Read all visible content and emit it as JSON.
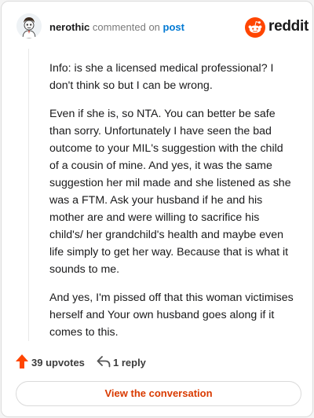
{
  "header": {
    "username": "nerothic",
    "action_text": " commented on ",
    "post_link": "post"
  },
  "brand": {
    "wordmark": "reddit",
    "accent": "#ff4500"
  },
  "comment": {
    "paragraphs": [
      "Info: is she a licensed medical professional? I don't think so but I can be wrong.",
      "Even if she is, so NTA. You can better be safe than sorry. Unfortunately I have seen the bad outcome to your MIL's suggestion with the child of a cousin of mine. And yes, it was the same suggestion her mil made and she listened as she was a FTM. Ask your husband if he and his mother are and were willing to sacrifice his child's/ her grandchild's health and maybe even life simply to get her way. Because that is what it sounds to me.",
      "And yes, I'm pissed off that this woman victimises herself and Your own husband goes along if it comes to this."
    ]
  },
  "actions": {
    "upvotes_label": "39 upvotes",
    "reply_label": "1 reply",
    "upvote_icon": "upvote-arrow-icon",
    "reply_icon": "reply-arrow-icon"
  },
  "cta": {
    "label": "View the conversation",
    "color": "#d93a00"
  }
}
